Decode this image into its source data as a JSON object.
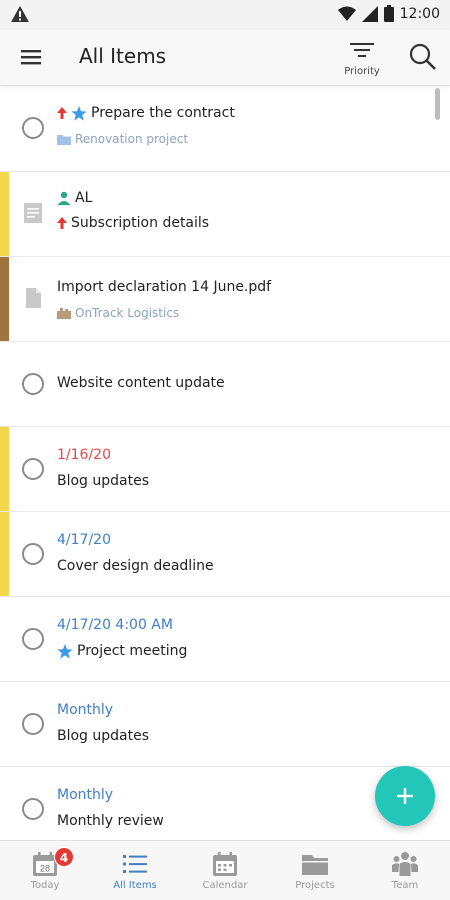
{
  "status_bar": {
    "time": "12:00"
  },
  "app_bar": {
    "title": "All Items",
    "sort_label": "Priority"
  },
  "items": [
    {
      "title": "Prepare the contract",
      "project": "Renovation project"
    },
    {
      "assignee": "AL",
      "title": "Subscription details"
    },
    {
      "title": "Import declaration 14 June.pdf",
      "project": "OnTrack Logistics"
    },
    {
      "title": "Website content update"
    },
    {
      "date": "1/16/20",
      "title": "Blog updates"
    },
    {
      "date": "4/17/20",
      "title": "Cover design deadline"
    },
    {
      "date": "4/17/20 4:00 AM",
      "title": "Project meeting"
    },
    {
      "date": "Monthly",
      "title": "Blog updates"
    },
    {
      "date": "Monthly",
      "title": "Monthly review"
    }
  ],
  "bottom_nav": [
    {
      "label": "Today",
      "icon": "calendar-day-icon",
      "badge": "4",
      "day": "28"
    },
    {
      "label": "All Items",
      "icon": "list-icon"
    },
    {
      "label": "Calendar",
      "icon": "calendar-icon"
    },
    {
      "label": "Projects",
      "icon": "folder-icon"
    },
    {
      "label": "Team",
      "icon": "team-icon"
    }
  ],
  "colors": {
    "accent": "#3f7fc4",
    "fab": "#22c7b8",
    "priority_high": "#e53935",
    "star": "#3b9be5",
    "stripe_yellow": "#f2d64b",
    "stripe_brown": "#a0723c",
    "overdue": "#e34a4a"
  }
}
